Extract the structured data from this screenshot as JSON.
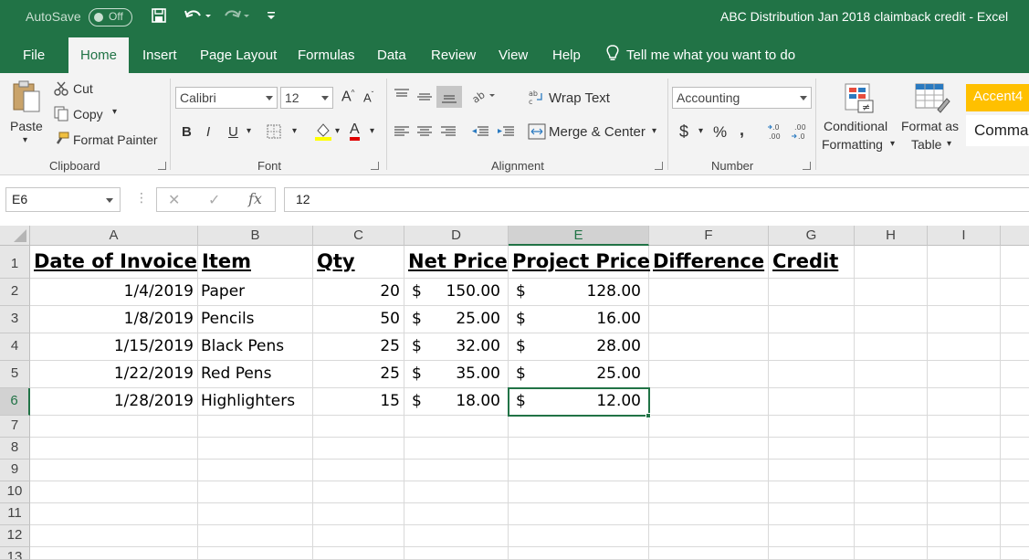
{
  "titlebar": {
    "autosave_label": "AutoSave",
    "autosave_state": "Off",
    "doc_title": "ABC Distribution Jan 2018 claimback credit  -  Excel"
  },
  "tabs": [
    "File",
    "Home",
    "Insert",
    "Page Layout",
    "Formulas",
    "Data",
    "Review",
    "View",
    "Help"
  ],
  "tell_me": "Tell me what you want to do",
  "ribbon": {
    "clipboard": {
      "paste": "Paste",
      "cut": "Cut",
      "copy": "Copy",
      "format_painter": "Format Painter",
      "label": "Clipboard"
    },
    "font": {
      "family": "Calibri",
      "size": "12",
      "bold": "B",
      "italic": "I",
      "underline": "U",
      "font_color": "A",
      "label": "Font"
    },
    "alignment": {
      "wrap": "Wrap Text",
      "merge": "Merge & Center",
      "label": "Alignment"
    },
    "number": {
      "format": "Accounting",
      "currency": "$",
      "percent": "%",
      "comma": ",",
      "inc_dec": ".0 .00",
      "label": "Number"
    },
    "styles": {
      "conditional_1": "Conditional",
      "conditional_2": "Formatting",
      "table_1": "Format as",
      "table_2": "Table",
      "accent": "Accent4",
      "comma_style": "Comma"
    }
  },
  "formula_bar": {
    "name_box": "E6",
    "fx": "fx",
    "value": "12"
  },
  "columns": [
    "A",
    "B",
    "C",
    "D",
    "E",
    "F",
    "G",
    "H",
    "I"
  ],
  "rows": [
    "1",
    "2",
    "3",
    "4",
    "5",
    "6",
    "7",
    "8",
    "9",
    "10",
    "11",
    "12",
    "13"
  ],
  "headers": {
    "a": "Date of Invoice",
    "b": "Item",
    "c": "Qty",
    "d": "Net Price",
    "e": "Project Price",
    "f": "Difference",
    "g": "Credit"
  },
  "currency_symbol": "$",
  "data_rows": [
    {
      "date": "1/4/2019",
      "item": "Paper",
      "qty": "20",
      "net": "150.00",
      "project": "128.00"
    },
    {
      "date": "1/8/2019",
      "item": "Pencils",
      "qty": "50",
      "net": "25.00",
      "project": "16.00"
    },
    {
      "date": "1/15/2019",
      "item": "Black Pens",
      "qty": "25",
      "net": "32.00",
      "project": "28.00"
    },
    {
      "date": "1/22/2019",
      "item": "Red Pens",
      "qty": "25",
      "net": "35.00",
      "project": "25.00"
    },
    {
      "date": "1/28/2019",
      "item": "Highlighters",
      "qty": "15",
      "net": "18.00",
      "project": "12.00"
    }
  ],
  "colors": {
    "accent": "#217346",
    "style_accent": "#ffc000"
  }
}
